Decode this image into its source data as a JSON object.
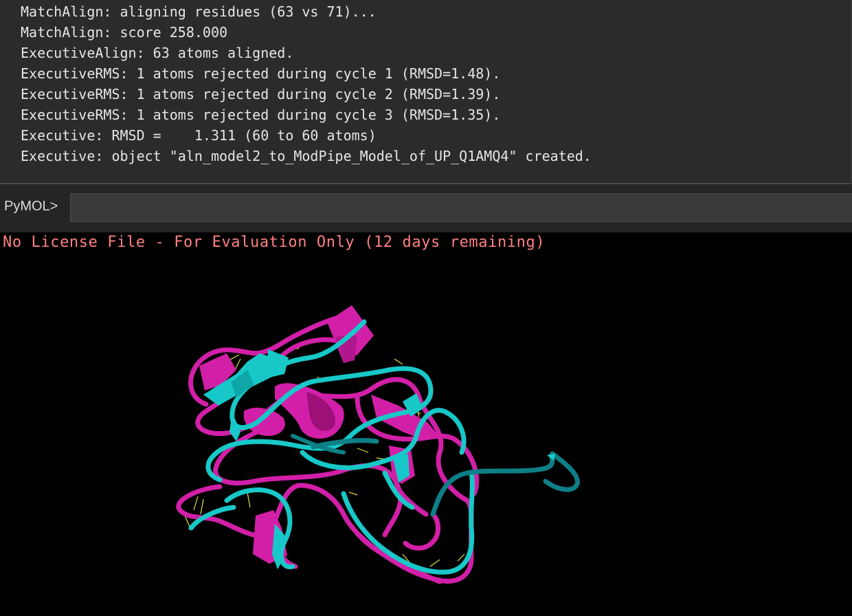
{
  "log": {
    "lines": [
      "MatchAlign: aligning residues (63 vs 71)...",
      "MatchAlign: score 258.000",
      "ExecutiveAlign: 63 atoms aligned.",
      "ExecutiveRMS: 1 atoms rejected during cycle 1 (RMSD=1.48).",
      "ExecutiveRMS: 1 atoms rejected during cycle 2 (RMSD=1.39).",
      "ExecutiveRMS: 1 atoms rejected during cycle 3 (RMSD=1.35).",
      "Executive: RMSD =    1.311 (60 to 60 atoms)",
      "Executive: object \"aln_model2_to_ModPipe_Model_of_UP_Q1AMQ4\" created."
    ]
  },
  "command": {
    "prompt": "PyMOL>",
    "value": ""
  },
  "viewer": {
    "license_banner": "No License File - For Evaluation Only (12 days remaining)",
    "colors": {
      "background": "#000000",
      "model_a": "#d21fa8",
      "model_b": "#18c8c8",
      "model_b_dark": "#0e7f86",
      "alignment_lines": "#e8e23a",
      "banner": "#ff8080"
    }
  }
}
